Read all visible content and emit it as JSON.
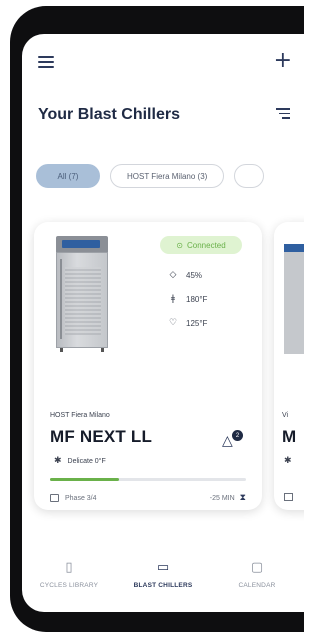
{
  "header": {
    "title": "Your Blast Chillers"
  },
  "filters": {
    "chips": [
      "All (7)",
      "HOST Fiera Milano (3)"
    ]
  },
  "card": {
    "status": "Connected",
    "metrics": {
      "humidity": "45%",
      "core_temp": "180°F",
      "air_temp": "125°F"
    },
    "location": "HOST Fiera Milano",
    "model": "MF NEXT LL",
    "notification_count": "2",
    "mode": "Delicate 0°F",
    "progress": 0.35,
    "phase": "Phase 3/4",
    "remaining": "-25 MIN"
  },
  "next_card": {
    "location": "Vi",
    "model": "M"
  },
  "bottom_nav": {
    "items": [
      "CYCLES LIBRARY",
      "BLAST CHILLERS",
      "CALENDAR"
    ],
    "active": "BLAST CHILLERS"
  },
  "colors": {
    "primary": "#2d3a5c",
    "success": "#6ab14a",
    "chip_active": "#a9bfd8"
  }
}
